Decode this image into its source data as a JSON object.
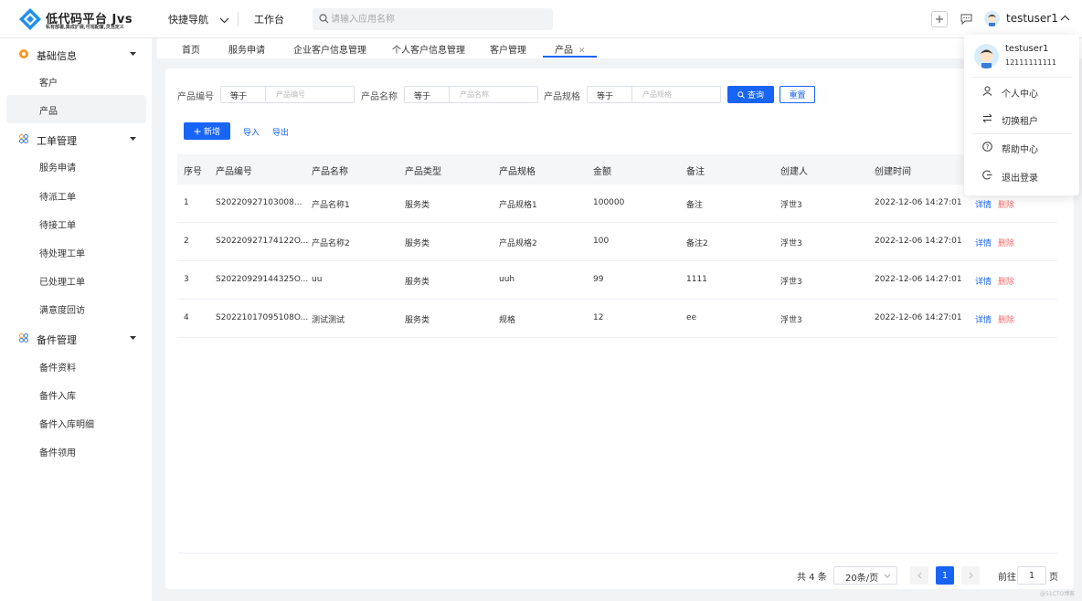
{
  "header": {
    "logo_title": "低代码平台 Jvs",
    "logo_subtitle": "私有部署,集成扩展,可视配置,灵活定义",
    "quick_nav": "快捷导航",
    "workbench": "工作台",
    "search_placeholder": "请输入应用名称",
    "username": "testuser1"
  },
  "sidebar": {
    "groups": [
      {
        "label": "基础信息",
        "icon": "basic-info-icon",
        "items": [
          "客户",
          "产品"
        ]
      },
      {
        "label": "工单管理",
        "icon": "grid-icon",
        "items": [
          "服务申请",
          "待派工单",
          "待接工单",
          "待处理工单",
          "已处理工单",
          "满意度回访"
        ]
      },
      {
        "label": "备件管理",
        "icon": "grid-icon",
        "items": [
          "备件资料",
          "备件入库",
          "备件入库明细",
          "备件领用"
        ]
      }
    ],
    "active_item": "产品"
  },
  "tabs": [
    "首页",
    "服务申请",
    "企业客户信息管理",
    "个人客户信息管理",
    "客户管理",
    "产品"
  ],
  "filters": [
    {
      "label": "产品编号",
      "operator": "等于",
      "placeholder": "产品编号"
    },
    {
      "label": "产品名称",
      "operator": "等于",
      "placeholder": "产品名称"
    },
    {
      "label": "产品规格",
      "operator": "等于",
      "placeholder": "产品规格"
    }
  ],
  "buttons": {
    "query": "查询",
    "reset": "重置",
    "add": "新增",
    "import": "导入",
    "export": "导出"
  },
  "table": {
    "columns": [
      "序号",
      "产品编号",
      "产品名称",
      "产品类型",
      "产品规格",
      "金额",
      "备注",
      "创建人",
      "创建时间"
    ],
    "rows": [
      [
        "1",
        "S20220927103008...",
        "产品名称1",
        "服务类",
        "产品规格1",
        "100000",
        "备注",
        "浮世3",
        "2022-12-06 14:27:01"
      ],
      [
        "2",
        "S20220927174122O...",
        "产品名称2",
        "服务类",
        "产品规格2",
        "100",
        "备注2",
        "浮世3",
        "2022-12-06 14:27:01"
      ],
      [
        "3",
        "S20220929144325O...",
        "uu",
        "服务类",
        "uuh",
        "99",
        "1111",
        "浮世3",
        "2022-12-06 14:27:01"
      ],
      [
        "4",
        "S20221017095108O...",
        "测试测试",
        "服务类",
        "规格",
        "12",
        "ee",
        "浮世3",
        "2022-12-06 14:27:01"
      ]
    ],
    "row_actions": {
      "detail": "详情",
      "delete": "删除"
    }
  },
  "pagination": {
    "total": "共 4 条",
    "page_size": "20条/页",
    "current_page": "1",
    "goto_label": "前往",
    "goto_value": "1",
    "page_suffix": "页"
  },
  "user_menu": {
    "name": "testuser1",
    "phone": "12111111111",
    "items": [
      {
        "label": "个人中心",
        "icon": "user-icon"
      },
      {
        "label": "切换租户",
        "icon": "switch-icon"
      },
      {
        "label": "帮助中心",
        "icon": "help-icon"
      },
      {
        "label": "退出登录",
        "icon": "logout-icon"
      }
    ]
  },
  "watermark": "@51CTO博客",
  "colors": {
    "primary": "#1764f5",
    "danger": "#f56c6c",
    "background": "#f2f3f5"
  }
}
